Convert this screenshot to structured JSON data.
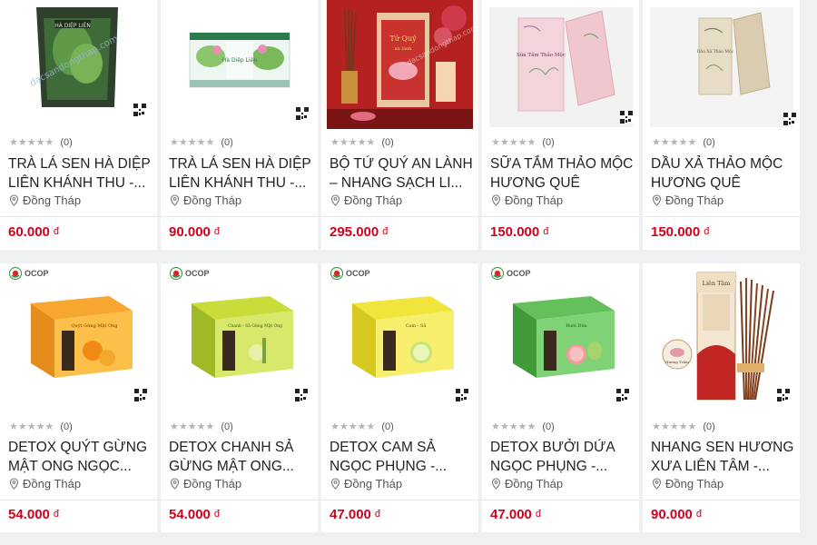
{
  "colors": {
    "price": "#d0021b",
    "stars": "#b5b5b5",
    "background": "#eef0f2"
  },
  "currency": "đ",
  "products": [
    {
      "title": "TRÀ LÁ SEN HÀ DIỆP LIÊN KHÁNH THU -...",
      "rating_count": "(0)",
      "location": "Đồng Tháp",
      "price": "60.000",
      "ocop": false,
      "image": "green-tea-pouch"
    },
    {
      "title": "TRÀ LÁ SEN HÀ DIỆP LIÊN KHÁNH THU -...",
      "rating_count": "(0)",
      "location": "Đồng Tháp",
      "price": "90.000",
      "ocop": false,
      "image": "lotus-tea-box"
    },
    {
      "title": "BỘ TỨ QUÝ AN LÀNH – NHANG SẠCH LI...",
      "rating_count": "(0)",
      "location": "Đồng Tháp",
      "price": "295.000",
      "ocop": false,
      "image": "incense-gift-set"
    },
    {
      "title": "SỮA TẮM THẢO MỘC HƯƠNG QUÊ",
      "rating_count": "(0)",
      "location": "Đồng Tháp",
      "price": "150.000",
      "ocop": false,
      "image": "pink-herbal-box"
    },
    {
      "title": "DẦU XẢ THẢO MỘC HƯƠNG QUÊ",
      "rating_count": "(0)",
      "location": "Đồng Tháp",
      "price": "150.000",
      "ocop": false,
      "image": "beige-herbal-box"
    },
    {
      "title": "DETOX QUÝT GỪNG MẬT ONG NGỌC...",
      "rating_count": "(0)",
      "location": "Đồng Tháp",
      "price": "54.000",
      "ocop": true,
      "image": "orange-detox-box"
    },
    {
      "title": "DETOX CHANH SẢ GỪNG MẬT ONG...",
      "rating_count": "(0)",
      "location": "Đồng Tháp",
      "price": "54.000",
      "ocop": true,
      "image": "lime-detox-box"
    },
    {
      "title": "DETOX CAM SẢ NGỌC PHỤNG -...",
      "rating_count": "(0)",
      "location": "Đồng Tháp",
      "price": "47.000",
      "ocop": true,
      "image": "yellow-detox-box"
    },
    {
      "title": "DETOX BƯỞI DỨA NGỌC PHỤNG -...",
      "rating_count": "(0)",
      "location": "Đồng Tháp",
      "price": "47.000",
      "ocop": true,
      "image": "green-detox-box"
    },
    {
      "title": "NHANG SEN HƯƠNG XƯA LIÊN TÂM -...",
      "rating_count": "(0)",
      "location": "Đồng Tháp",
      "price": "90.000",
      "ocop": false,
      "image": "incense-sticks"
    }
  ],
  "ocop_label": "OCOP",
  "image_text": {
    "watermark": "dacsandongthap.com",
    "tea_pouch_label": "HÀ DIỆP LIÊN",
    "tea_box_label": "Hà Diệp Liên",
    "gift_title": "Tứ Quý",
    "gift_sub": "an lành",
    "herbal_label": "Sữa Tắm Thảo Mộc",
    "herbal_label_2": "Dầu Xả Thảo Mộc",
    "detox_1": "Quýt Gừng Mật Ong",
    "detox_2": "Chanh - Sả Gừng Mật Ong",
    "detox_3": "Cam - Sả",
    "detox_4": "Bưởi Dứa",
    "incense_brand": "Liên Tâm",
    "incense_sub": "Hương Trầm"
  }
}
